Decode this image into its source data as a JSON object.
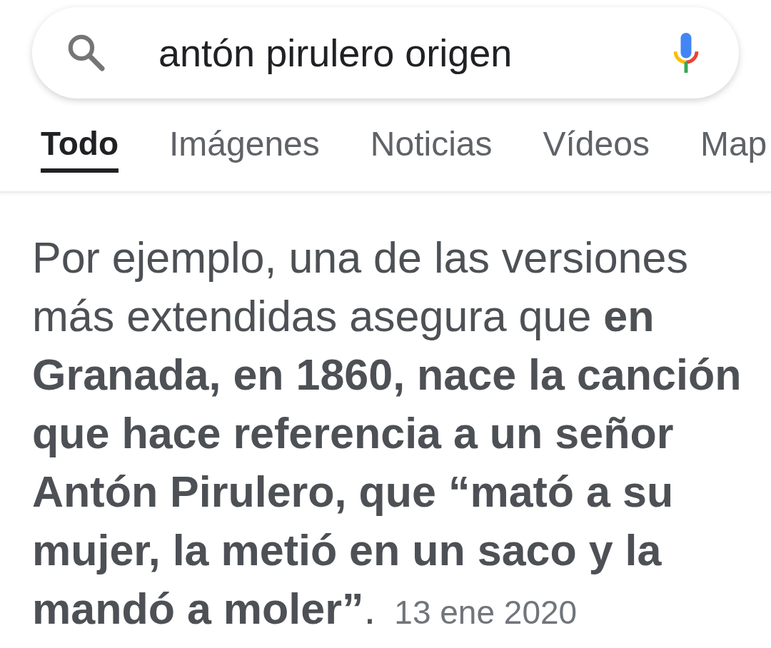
{
  "search": {
    "value": "antón pirulero origen"
  },
  "tabs": [
    {
      "label": "Todo",
      "selected": true
    },
    {
      "label": "Imágenes",
      "selected": false
    },
    {
      "label": "Noticias",
      "selected": false
    },
    {
      "label": "Vídeos",
      "selected": false
    },
    {
      "label": "Map",
      "selected": false
    }
  ],
  "snippet": {
    "text": "Por ejemplo, una de las versiones más extendidas asegura que **en Granada, en 1860, nace la canción que hace referencia a un señor Antón Pirulero, que “mató a su mujer, la metió en un saco y la mandó a moler”**.",
    "date": "13 ene 2020"
  }
}
